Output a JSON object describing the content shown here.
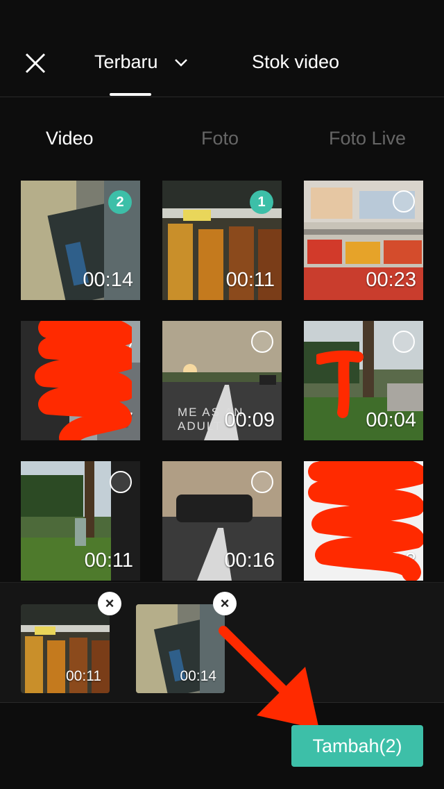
{
  "header": {
    "close_icon": "close-icon",
    "tab_recent": "Terbaru",
    "tab_stock": "Stok video",
    "dropdown_icon": "chevron-down-icon"
  },
  "subtabs": [
    "Video",
    "Foto",
    "Foto Live"
  ],
  "grid": [
    {
      "duration": "00:14",
      "selected": 2
    },
    {
      "duration": "00:11",
      "selected": 1
    },
    {
      "duration": "00:23",
      "selected": null
    },
    {
      "duration": ":07",
      "selected": null
    },
    {
      "duration": "00:09",
      "selected": null,
      "overlay": "ME AS AN ADULT"
    },
    {
      "duration": "00:04",
      "selected": null
    },
    {
      "duration": "00:11",
      "selected": null
    },
    {
      "duration": "00:16",
      "selected": null
    },
    {
      "duration": "3",
      "selected": null
    }
  ],
  "selected_items": [
    {
      "duration": "00:11"
    },
    {
      "duration": "00:14"
    }
  ],
  "add_button": "Tambah(2)",
  "colors": {
    "accent": "#3dbfa8",
    "background": "#0d0d0d",
    "redaction": "#ff2a00"
  }
}
